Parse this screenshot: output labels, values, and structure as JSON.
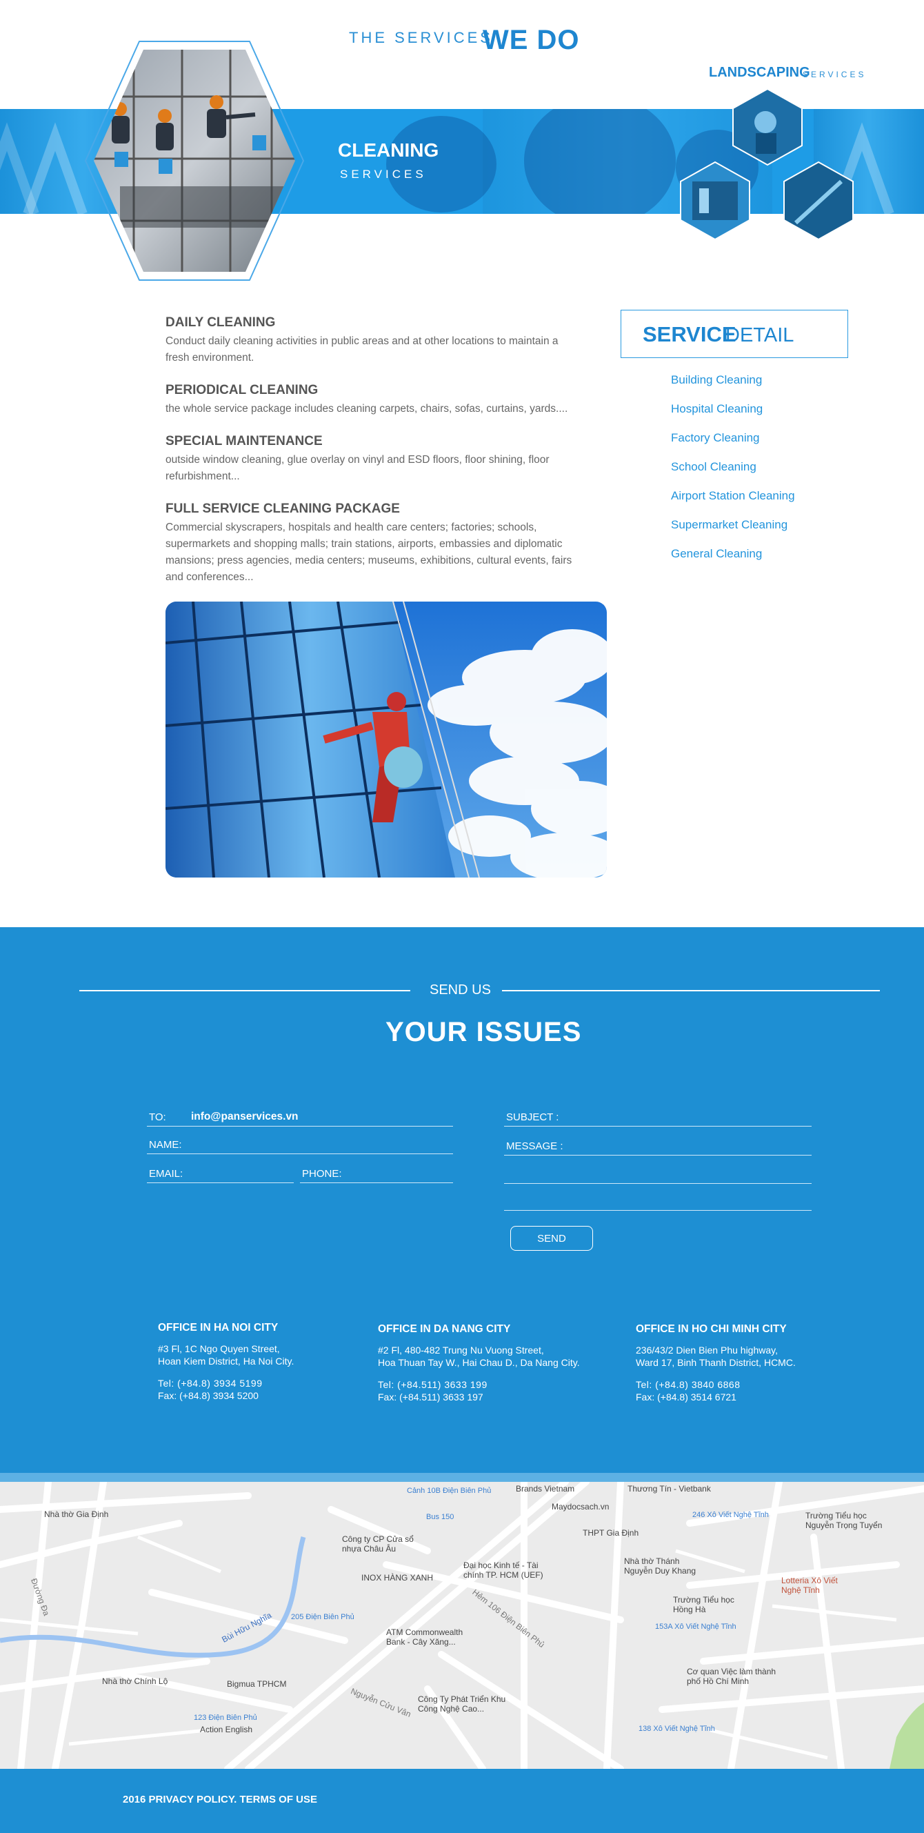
{
  "hero": {
    "title_light": "THE SERVICES",
    "title_bold": "WE DO",
    "landscaping_main": "LANDSCAPING",
    "landscaping_sub": "SERVICES",
    "cleaning_main": "CLEANING",
    "cleaning_sub": "SERVICES"
  },
  "services": [
    {
      "title": "DAILY CLEANING",
      "desc": "Conduct daily cleaning activities in public areas and at other locations to maintain a fresh environment."
    },
    {
      "title": "PERIODICAL CLEANING",
      "desc": "the whole service package includes cleaning carpets, chairs, sofas, curtains, yards...."
    },
    {
      "title": "SPECIAL MAINTENANCE",
      "desc": "outside window cleaning, glue overlay on vinyl and ESD floors, floor shining, floor refurbishment..."
    },
    {
      "title": "FULL SERVICE CLEANING PACKAGE",
      "desc": "Commercial skyscrapers, hospitals and health care centers; factories; schools, supermarkets and shopping malls; train stations, airports, embassies and diplomatic mansions; press agencies, media centers; museums, exhibitions, cultural events, fairs and conferences..."
    }
  ],
  "service_detail": {
    "title_bold": "SERVICE",
    "title_light": "DETAIL",
    "links": [
      "Building Cleaning",
      "Hospital Cleaning",
      "Factory Cleaning",
      "School Cleaning",
      "Airport Station Cleaning",
      "Supermarket Cleaning",
      "General Cleaning"
    ]
  },
  "contact": {
    "send_us": "SEND US",
    "heading": "YOUR ISSUES",
    "to_label": "TO:",
    "to_value": "info@panservices.vn",
    "name_label": "NAME:",
    "email_label": "EMAIL:",
    "phone_label": "PHONE:",
    "subject_label": "SUBJECT   :",
    "message_label": "MESSAGE :",
    "send_button": "SEND"
  },
  "offices": [
    {
      "title": "OFFICE IN HA NOI CITY",
      "addr1": "#3 Fl, 1C Ngo Quyen Street,",
      "addr2": "Hoan Kiem District, Ha Noi City.",
      "tel": "Tel:   (+84.8) 3934 5199",
      "fax": "Fax:  (+84.8) 3934 5200"
    },
    {
      "title": "OFFICE IN DA NANG CITY",
      "addr1": "#2 Fl, 480-482 Trung Nu Vuong Street,",
      "addr2": "Hoa Thuan Tay W., Hai Chau D., Da Nang City.",
      "tel": "Tel:    (+84.511) 3633 199",
      "fax": "Fax:   (+84.511) 3633 197"
    },
    {
      "title": "OFFICE IN HO CHI MINH CITY",
      "addr1": "236/43/2 Dien Bien Phu highway,",
      "addr2": "Ward 17, Binh Thanh District, HCMC.",
      "tel": "Tel:   (+84.8) 3840 6868",
      "fax": "Fax:  (+84.8) 3514 6721"
    }
  ],
  "map": {
    "labels": [
      "Nhà thờ Gia Định",
      "Brands Vietnam",
      "Thương Tín - Vietbank",
      "Maydocsach.vn",
      "Công ty CP Cửa sổ nhựa Châu Âu",
      "Bus 150",
      "INOX HÀNG XANH",
      "Đại học Kinh tế - Tài chính TP. HCM (UEF)",
      "THPT Gia Định",
      "246 Xô Viết Nghệ Tĩnh",
      "Trường Tiểu học Nguyễn Trọng Tuyển",
      "Nhà thờ Thánh Nguyễn Duy Khang",
      "Lotteria Xô Viết Nghệ Tĩnh",
      "Trường Tiểu học Hồng Hà",
      "153A Xô Viết Nghệ Tĩnh",
      "205 Điện Biên Phủ",
      "ATM Commonwealth Bank - Cây Xăng...",
      "Nhà thờ Chính Lộ",
      "Bigmua TPHCM",
      "123 Điện Biên Phủ",
      "Action English",
      "Công Ty Phát Triển Khu Công Nghệ Cao...",
      "Cơ quan Việc làm thành phố Hồ Chí Minh",
      "138 Xô Viết Nghệ Tĩnh",
      "Cảnh 10B Điện Biên Phủ",
      "Bùi Hữu Nghĩa",
      "Hẻm 106 Điện Biên Phủ",
      "Nguyễn Cửu Vân",
      "Đường Đa"
    ]
  },
  "footer": {
    "text": "2016  PRIVACY POLICY. TERMS OF USE"
  },
  "colors": {
    "brand_blue": "#1e8fd3",
    "accent_blue": "#1e86d0",
    "white": "#ffffff"
  }
}
